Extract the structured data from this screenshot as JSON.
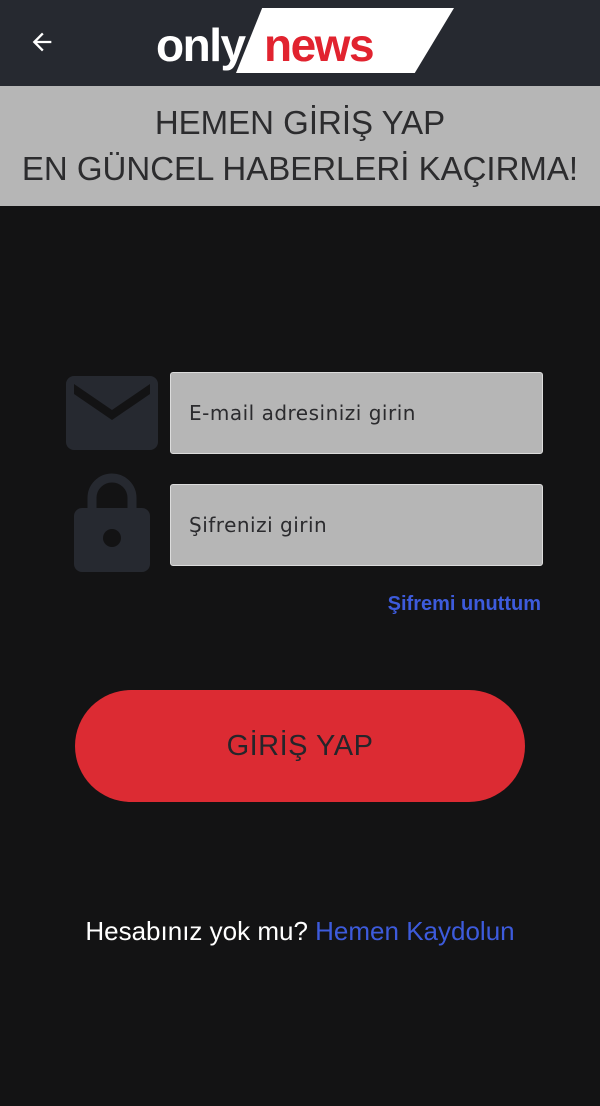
{
  "header": {
    "back_icon": "arrow-left-icon",
    "logo": {
      "part1": "only",
      "part2": "news"
    }
  },
  "banner": {
    "line1": "HEMEN GİRİŞ YAP",
    "line2": "EN GÜNCEL HABERLERİ KAÇIRMA!"
  },
  "form": {
    "email_icon": "envelope-icon",
    "email_placeholder": "E-mail adresinizi girin",
    "email_value": "",
    "password_icon": "lock-icon",
    "password_placeholder": "Şifrenizi girin",
    "password_value": "",
    "forgot_label": "Şifremi unuttum",
    "login_label": "GİRİŞ YAP"
  },
  "signup": {
    "prompt": "Hesabınız yok mu?",
    "link": "Hemen Kaydolun"
  },
  "colors": {
    "background": "#131314",
    "app_bar": "#262930",
    "banner": "#b6b6b6",
    "accent_red": "#dc2b33",
    "link_blue": "#3d5bdc",
    "icon_gray": "#262930"
  }
}
